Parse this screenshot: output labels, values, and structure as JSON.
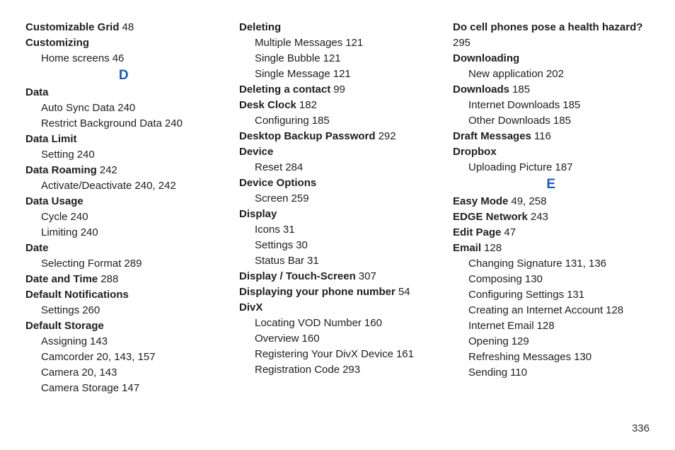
{
  "page_number": "336",
  "columns": [
    {
      "items": [
        {
          "type": "term-page",
          "term": "Customizable Grid",
          "pages": "48"
        },
        {
          "type": "term",
          "term": "Customizing"
        },
        {
          "type": "sub-page",
          "label": "Home screens",
          "pages": "46"
        },
        {
          "type": "letter",
          "value": "D"
        },
        {
          "type": "term",
          "term": "Data"
        },
        {
          "type": "sub-page",
          "label": "Auto Sync Data",
          "pages": "240"
        },
        {
          "type": "sub-page",
          "label": "Restrict Background Data",
          "pages": "240"
        },
        {
          "type": "term",
          "term": "Data Limit"
        },
        {
          "type": "sub-page",
          "label": "Setting",
          "pages": "240"
        },
        {
          "type": "term-page",
          "term": "Data Roaming",
          "pages": "242"
        },
        {
          "type": "sub-page",
          "label": "Activate/Deactivate",
          "pages": "240, 242"
        },
        {
          "type": "term",
          "term": "Data Usage"
        },
        {
          "type": "sub-page",
          "label": "Cycle",
          "pages": "240"
        },
        {
          "type": "sub-page",
          "label": "Limiting",
          "pages": "240"
        },
        {
          "type": "term",
          "term": "Date"
        },
        {
          "type": "sub-page",
          "label": "Selecting Format",
          "pages": "289"
        },
        {
          "type": "term-page",
          "term": "Date and Time",
          "pages": "288"
        },
        {
          "type": "term",
          "term": "Default Notifications"
        },
        {
          "type": "sub-page",
          "label": "Settings",
          "pages": "260"
        },
        {
          "type": "term",
          "term": "Default Storage"
        },
        {
          "type": "sub-page",
          "label": "Assigning",
          "pages": "143"
        },
        {
          "type": "sub-page",
          "label": "Camcorder",
          "pages": "20, 143, 157"
        },
        {
          "type": "sub-page",
          "label": "Camera",
          "pages": "20, 143"
        },
        {
          "type": "sub-page",
          "label": "Camera Storage",
          "pages": "147"
        }
      ]
    },
    {
      "items": [
        {
          "type": "term",
          "term": "Deleting"
        },
        {
          "type": "sub-page",
          "label": "Multiple Messages",
          "pages": "121"
        },
        {
          "type": "sub-page",
          "label": "Single Bubble",
          "pages": "121"
        },
        {
          "type": "sub-page",
          "label": "Single Message",
          "pages": "121"
        },
        {
          "type": "term-page",
          "term": "Deleting a contact",
          "pages": "99"
        },
        {
          "type": "term-page",
          "term": "Desk Clock",
          "pages": "182"
        },
        {
          "type": "sub-page",
          "label": "Configuring",
          "pages": "185"
        },
        {
          "type": "term-page",
          "term": "Desktop Backup Password",
          "pages": "292"
        },
        {
          "type": "term",
          "term": "Device"
        },
        {
          "type": "sub-page",
          "label": "Reset",
          "pages": "284"
        },
        {
          "type": "term",
          "term": "Device Options"
        },
        {
          "type": "sub-page",
          "label": "Screen",
          "pages": "259"
        },
        {
          "type": "term",
          "term": "Display"
        },
        {
          "type": "sub-page",
          "label": "Icons",
          "pages": "31"
        },
        {
          "type": "sub-page",
          "label": "Settings",
          "pages": "30"
        },
        {
          "type": "sub-page",
          "label": "Status Bar",
          "pages": "31"
        },
        {
          "type": "term-page",
          "term": "Display / Touch-Screen",
          "pages": "307"
        },
        {
          "type": "term-page",
          "term": "Displaying your phone number",
          "pages": "54"
        },
        {
          "type": "term",
          "term": "DivX"
        },
        {
          "type": "sub-page",
          "label": "Locating VOD Number",
          "pages": "160"
        },
        {
          "type": "sub-page",
          "label": "Overview",
          "pages": "160"
        },
        {
          "type": "sub-page",
          "label": "Registering Your DivX Device",
          "pages": "161"
        },
        {
          "type": "sub-page",
          "label": "Registration Code",
          "pages": "293"
        }
      ]
    },
    {
      "items": [
        {
          "type": "term-page-multi",
          "term": "Do cell phones pose a health hazard?",
          "pages": "295"
        },
        {
          "type": "term",
          "term": "Downloading"
        },
        {
          "type": "sub-page",
          "label": "New application",
          "pages": "202"
        },
        {
          "type": "term-page",
          "term": "Downloads",
          "pages": "185"
        },
        {
          "type": "sub-page",
          "label": "Internet Downloads",
          "pages": "185"
        },
        {
          "type": "sub-page",
          "label": "Other Downloads",
          "pages": "185"
        },
        {
          "type": "term-page",
          "term": "Draft Messages",
          "pages": "116"
        },
        {
          "type": "term",
          "term": "Dropbox"
        },
        {
          "type": "sub-page",
          "label": "Uploading Picture",
          "pages": "187"
        },
        {
          "type": "letter",
          "value": "E"
        },
        {
          "type": "term-page",
          "term": "Easy Mode",
          "pages": "49, 258"
        },
        {
          "type": "term-page",
          "term": "EDGE Network",
          "pages": "243"
        },
        {
          "type": "term-page",
          "term": "Edit Page",
          "pages": "47"
        },
        {
          "type": "term-page",
          "term": "Email",
          "pages": "128"
        },
        {
          "type": "sub-page",
          "label": "Changing Signature",
          "pages": "131, 136"
        },
        {
          "type": "sub-page",
          "label": "Composing",
          "pages": "130"
        },
        {
          "type": "sub-page",
          "label": "Configuring Settings",
          "pages": "131"
        },
        {
          "type": "sub-page",
          "label": "Creating an Internet Account",
          "pages": "128"
        },
        {
          "type": "sub-page",
          "label": "Internet Email",
          "pages": "128"
        },
        {
          "type": "sub-page",
          "label": "Opening",
          "pages": "129"
        },
        {
          "type": "sub-page",
          "label": "Refreshing Messages",
          "pages": "130"
        },
        {
          "type": "sub-page",
          "label": "Sending",
          "pages": "110"
        }
      ]
    }
  ]
}
